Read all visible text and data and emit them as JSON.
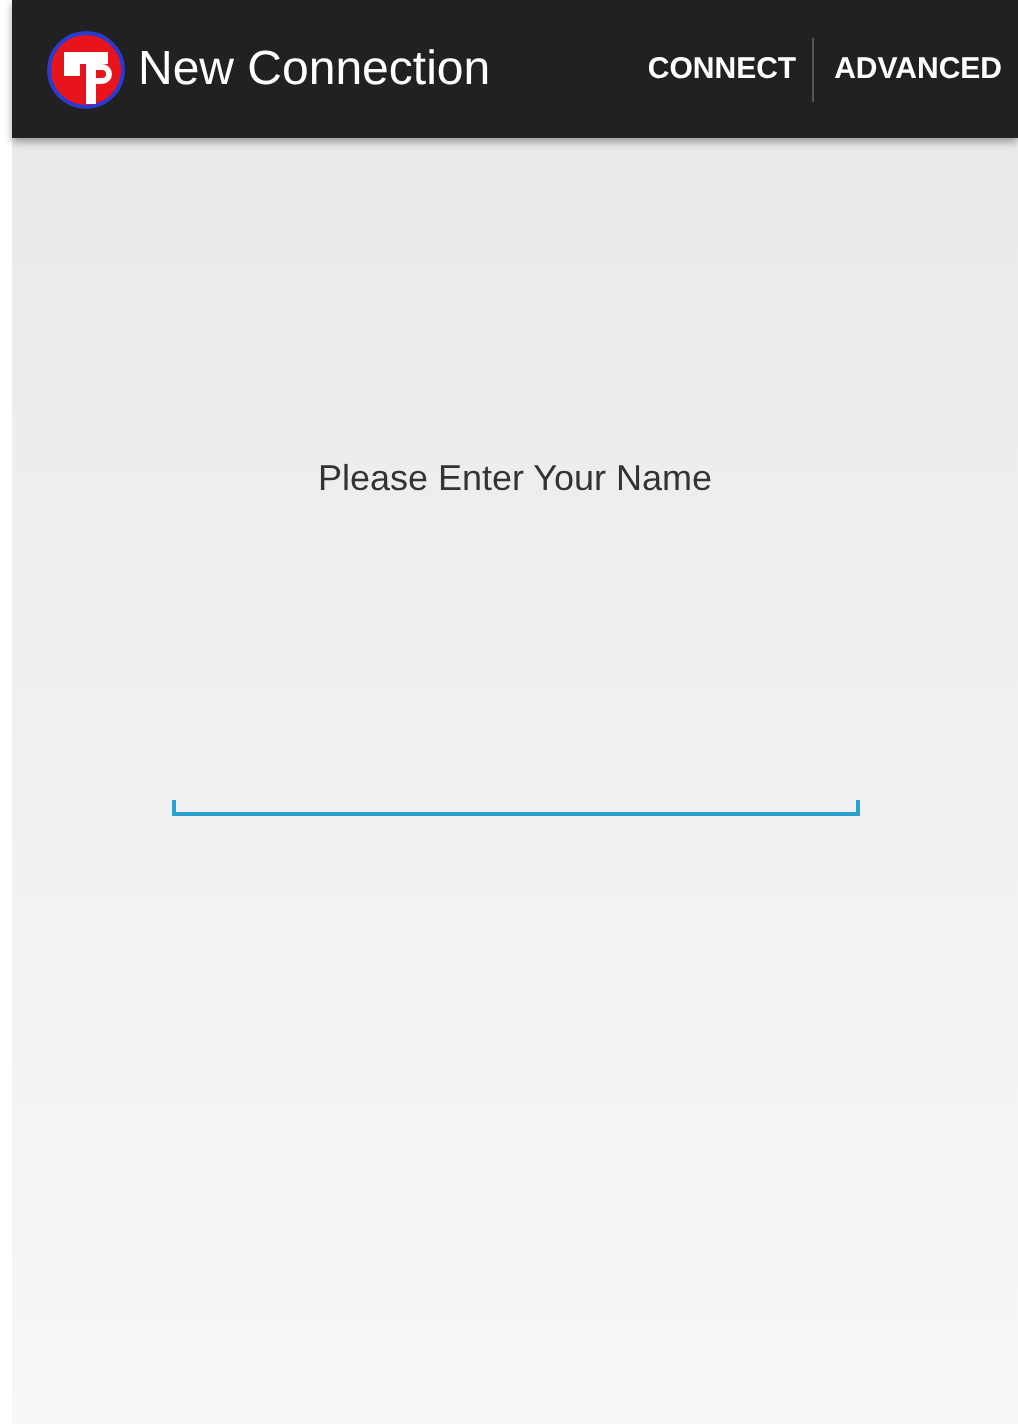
{
  "action_bar": {
    "title": "New Connection",
    "actions": [
      {
        "label": "CONNECT"
      },
      {
        "label": "ADVANCED"
      }
    ]
  },
  "prompt": "Please Enter Your Name"
}
